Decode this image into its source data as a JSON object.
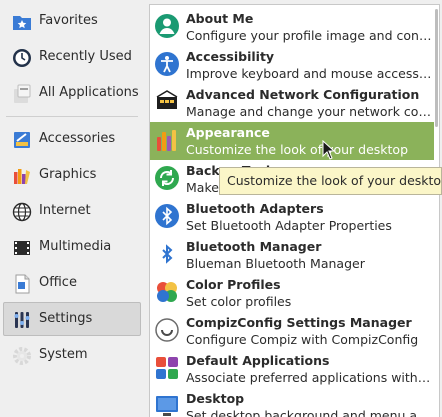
{
  "sidebar": {
    "categories": [
      {
        "label": "Favorites",
        "icon": "star-folder-icon"
      },
      {
        "label": "Recently Used",
        "icon": "clock-icon"
      },
      {
        "label": "All Applications",
        "icon": "applications-icon"
      },
      {
        "label": "Accessories",
        "icon": "accessories-icon"
      },
      {
        "label": "Graphics",
        "icon": "graphics-icon"
      },
      {
        "label": "Internet",
        "icon": "globe-icon"
      },
      {
        "label": "Multimedia",
        "icon": "film-icon"
      },
      {
        "label": "Office",
        "icon": "document-icon"
      },
      {
        "label": "Settings",
        "icon": "sliders-icon"
      },
      {
        "label": "System",
        "icon": "gear-icon"
      }
    ],
    "selected": "Settings"
  },
  "apps": [
    {
      "name": "About Me",
      "desc": "Configure your profile image and cont...",
      "icon": "user-icon"
    },
    {
      "name": "Accessibility",
      "desc": "Improve keyboard and mouse accessibi...",
      "icon": "accessibility-icon"
    },
    {
      "name": "Advanced Network Configuration",
      "desc": "Manage and change your network con...",
      "icon": "network-icon"
    },
    {
      "name": "Appearance",
      "desc": "Customize the look of your desktop",
      "icon": "palette-icon"
    },
    {
      "name": "Backup Tool",
      "desc": "Make",
      "icon": "sync-icon"
    },
    {
      "name": "Bluetooth Adapters",
      "desc": "Set Bluetooth Adapter Properties",
      "icon": "bluetooth-icon"
    },
    {
      "name": "Bluetooth Manager",
      "desc": "Blueman Bluetooth Manager",
      "icon": "bluetooth-icon"
    },
    {
      "name": "Color Profiles",
      "desc": "Set color profiles",
      "icon": "color-profiles-icon"
    },
    {
      "name": "CompizConfig Settings Manager",
      "desc": "Configure Compiz with CompizConfig",
      "icon": "compiz-icon"
    },
    {
      "name": "Default Applications",
      "desc": "Associate preferred applications with ...",
      "icon": "default-apps-icon"
    },
    {
      "name": "Desktop",
      "desc": "Set desktop background and menu an...",
      "icon": "desktop-icon"
    }
  ],
  "highlighted_app": "Appearance",
  "tooltip": "Customize the look of your desktop",
  "colors": {
    "highlight": "#8bb25a",
    "tooltip_bg": "#fbf6c8",
    "accent_blue": "#3a7bd5"
  }
}
